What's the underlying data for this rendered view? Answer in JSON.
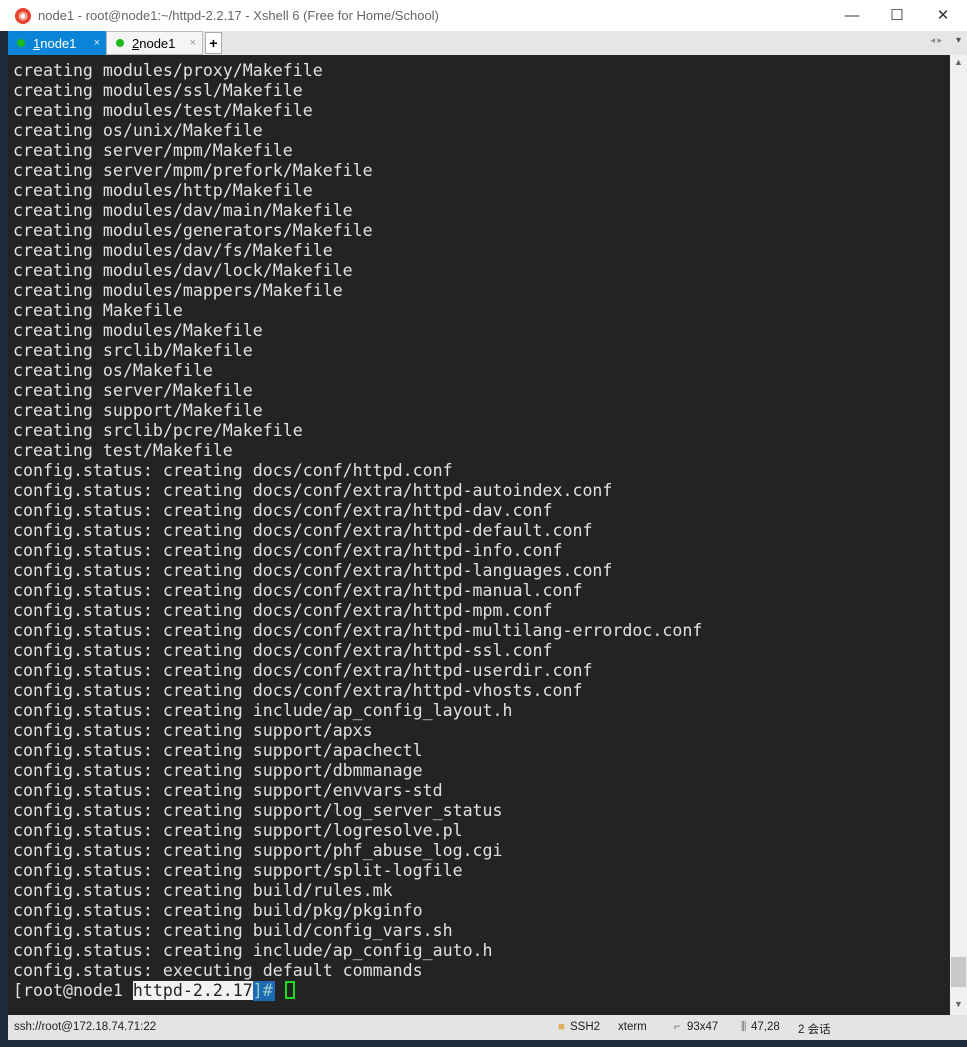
{
  "window": {
    "title": "node1 - root@node1:~/httpd-2.2.17 - Xshell 6 (Free for Home/School)",
    "minimize": "—",
    "maximize": "☐",
    "close": "✕"
  },
  "tabs": [
    {
      "num": "1",
      "label": " node1",
      "close": "×",
      "active": true
    },
    {
      "num": "2",
      "label": " node1",
      "close": "×",
      "active": false
    }
  ],
  "add_tab": "+",
  "tab_nav": "◂ ▸",
  "tab_menu": "▾",
  "terminal": {
    "lines": [
      "creating modules/proxy/Makefile",
      "creating modules/ssl/Makefile",
      "creating modules/test/Makefile",
      "creating os/unix/Makefile",
      "creating server/mpm/Makefile",
      "creating server/mpm/prefork/Makefile",
      "creating modules/http/Makefile",
      "creating modules/dav/main/Makefile",
      "creating modules/generators/Makefile",
      "creating modules/dav/fs/Makefile",
      "creating modules/dav/lock/Makefile",
      "creating modules/mappers/Makefile",
      "creating Makefile",
      "creating modules/Makefile",
      "creating srclib/Makefile",
      "creating os/Makefile",
      "creating server/Makefile",
      "creating support/Makefile",
      "creating srclib/pcre/Makefile",
      "creating test/Makefile",
      "config.status: creating docs/conf/httpd.conf",
      "config.status: creating docs/conf/extra/httpd-autoindex.conf",
      "config.status: creating docs/conf/extra/httpd-dav.conf",
      "config.status: creating docs/conf/extra/httpd-default.conf",
      "config.status: creating docs/conf/extra/httpd-info.conf",
      "config.status: creating docs/conf/extra/httpd-languages.conf",
      "config.status: creating docs/conf/extra/httpd-manual.conf",
      "config.status: creating docs/conf/extra/httpd-mpm.conf",
      "config.status: creating docs/conf/extra/httpd-multilang-errordoc.conf",
      "config.status: creating docs/conf/extra/httpd-ssl.conf",
      "config.status: creating docs/conf/extra/httpd-userdir.conf",
      "config.status: creating docs/conf/extra/httpd-vhosts.conf",
      "config.status: creating include/ap_config_layout.h",
      "config.status: creating support/apxs",
      "config.status: creating support/apachectl",
      "config.status: creating support/dbmmanage",
      "config.status: creating support/envvars-std",
      "config.status: creating support/log_server_status",
      "config.status: creating support/logresolve.pl",
      "config.status: creating support/phf_abuse_log.cgi",
      "config.status: creating support/split-logfile",
      "config.status: creating build/rules.mk",
      "config.status: creating build/pkg/pkginfo",
      "config.status: creating build/config_vars.sh",
      "config.status: creating include/ap_config_auto.h",
      "config.status: executing default commands"
    ],
    "prompt_prefix": "[root@node1 ",
    "prompt_dir": "httpd-2.2.17",
    "prompt_suffix": "]#"
  },
  "statusbar": {
    "connection": "ssh://root@172.18.74.71:22",
    "protocol": "SSH2",
    "term": "xterm",
    "size": "93x47",
    "cursor_pos": "47,28",
    "sessions": "2 会话"
  }
}
